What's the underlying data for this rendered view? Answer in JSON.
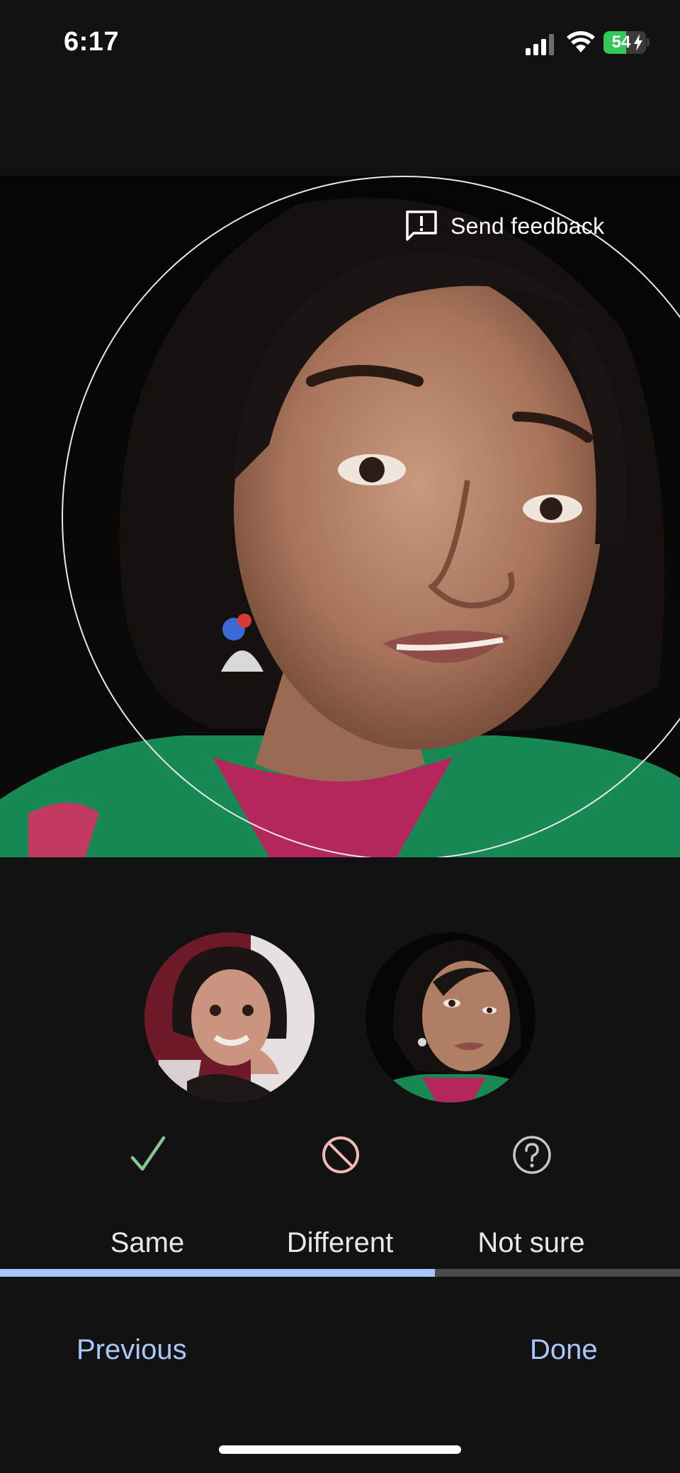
{
  "status_bar": {
    "time": "6:17",
    "battery_level": "54",
    "icons": [
      "signal-icon",
      "wifi-icon",
      "battery-icon",
      "charging-bolt-icon"
    ]
  },
  "photo": {
    "description_icon": "face-photo",
    "feedback_label": "Send feedback",
    "feedback_icon": "feedback-icon"
  },
  "thumbnails": {
    "left_icon": "face-thumbnail-child",
    "right_icon": "face-thumbnail-current"
  },
  "choices": {
    "same": {
      "label": "Same",
      "icon": "checkmark-icon",
      "color": "#81c995"
    },
    "different": {
      "label": "Different",
      "icon": "block-icon",
      "color": "#f2b8b5"
    },
    "not_sure": {
      "label": "Not sure",
      "icon": "help-circle-icon",
      "color": "#c7c7c7"
    }
  },
  "progress": {
    "fraction": 0.64,
    "fill_color": "#a8c7fa",
    "track_color": "#4a4a4a"
  },
  "nav": {
    "previous_label": "Previous",
    "done_label": "Done",
    "accent_color": "#a8c7fa"
  }
}
